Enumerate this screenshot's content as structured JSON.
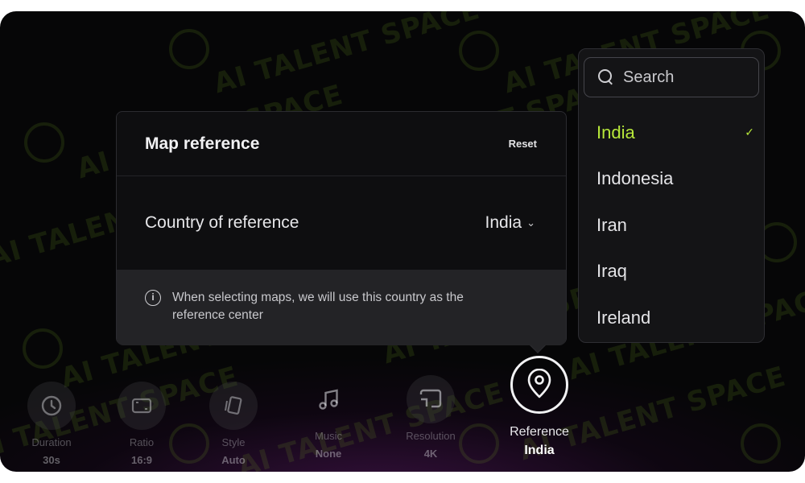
{
  "panel": {
    "title": "Map reference",
    "reset_label": "Reset",
    "row_label": "Country of reference",
    "row_value": "India",
    "info_text": "When selecting maps, we will use this country as the reference center"
  },
  "dropdown": {
    "search_placeholder": "Search",
    "options": [
      "India",
      "Indonesia",
      "Iran",
      "Iraq",
      "Ireland"
    ],
    "selected": "India"
  },
  "toolbar": [
    {
      "label": "Duration",
      "value": "30s",
      "icon": "clock-icon"
    },
    {
      "label": "Ratio",
      "value": "16:9",
      "icon": "aspect-ratio-icon"
    },
    {
      "label": "Style",
      "value": "Auto",
      "icon": "cards-icon"
    },
    {
      "label": "Music",
      "value": "None",
      "icon": "music-note-icon"
    },
    {
      "label": "Resolution",
      "value": "4K",
      "icon": "cast-screen-icon"
    },
    {
      "label": "Reference",
      "value": "India",
      "icon": "map-pin-icon",
      "active": true
    }
  ],
  "watermark": "AI TALENT SPACE",
  "colors": {
    "accent": "#b7e83a",
    "background": "#060607",
    "panel": "#0e0e10"
  }
}
